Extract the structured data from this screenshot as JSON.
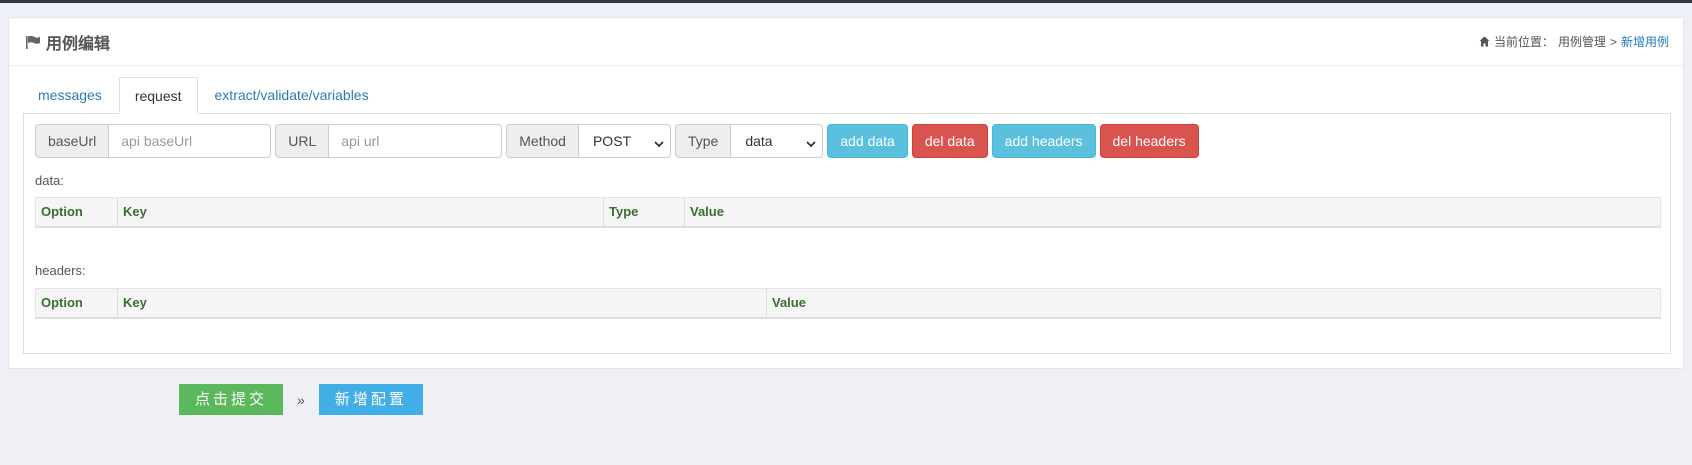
{
  "header": {
    "title": "用例编辑",
    "breadcrumb_prefix": "当前位置：",
    "breadcrumb_parent": "用例管理",
    "breadcrumb_sep": ">",
    "breadcrumb_current": "新增用例"
  },
  "tabs": [
    {
      "label": "messages",
      "active": false
    },
    {
      "label": "request",
      "active": true
    },
    {
      "label": "extract/validate/variables",
      "active": false
    }
  ],
  "toolbar": {
    "baseurl_label": "baseUrl",
    "baseurl_placeholder": "api baseUrl",
    "url_label": "URL",
    "url_placeholder": "api url",
    "method_label": "Method",
    "method_value": "POST",
    "type_label": "Type",
    "type_value": "data",
    "add_data": "add data",
    "del_data": "del data",
    "add_headers": "add headers",
    "del_headers": "del headers"
  },
  "data_table": {
    "label": "data:",
    "columns": [
      "Option",
      "Key",
      "Type",
      "Value"
    ]
  },
  "headers_table": {
    "label": "headers:",
    "columns": [
      "Option",
      "Key",
      "Value"
    ]
  },
  "actions": {
    "submit": "点击提交",
    "separator": "»",
    "add_config": "新增配置"
  },
  "colors": {
    "info": "#5bc0de",
    "danger": "#d9534f",
    "success": "#5cb85c",
    "link": "#1f7bbd",
    "header_text": "#3a6e2f"
  },
  "icons": {
    "title": "flag-icon",
    "breadcrumb": "home-icon",
    "select": "chevron-down-icon"
  }
}
